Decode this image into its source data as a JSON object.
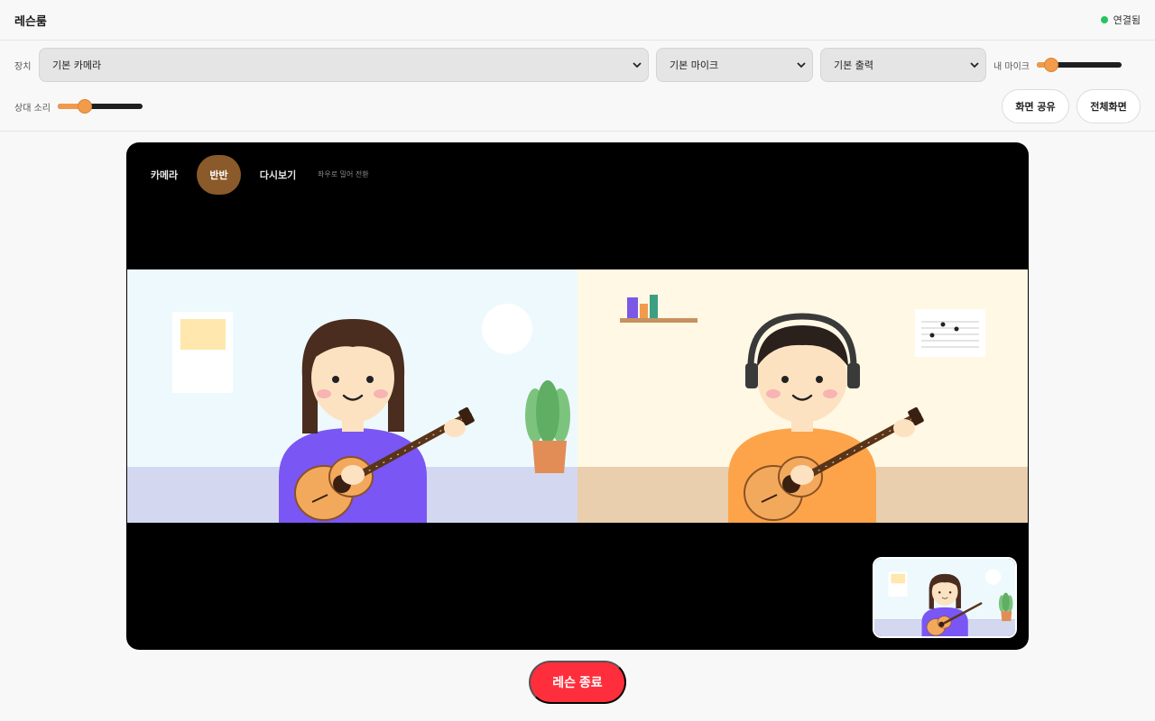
{
  "header": {
    "title": "레슨룸",
    "status": "연결됨",
    "status_color": "#22c55e"
  },
  "devices": {
    "label": "장치",
    "camera": "기본 카메라",
    "mic": "기본 마이크",
    "output": "기본 출력",
    "my_mic_label": "내 마이크",
    "my_mic_level": 0.1,
    "peer_sound_label": "상대 소리",
    "peer_sound_level": 0.28,
    "share_screen": "화면 공유",
    "fullscreen": "전체화면"
  },
  "stage": {
    "tabs": [
      {
        "label": "카메라",
        "active": false
      },
      {
        "label": "반반",
        "active": true
      },
      {
        "label": "다시보기",
        "active": false
      }
    ],
    "swipe_hint": "좌우로 밀어 전환"
  },
  "colors": {
    "accent_orange": "#f29b4b",
    "tab_active": "#8a5a2b",
    "end_button": "#ff2e3c"
  },
  "end_lesson": "레슨 종료"
}
